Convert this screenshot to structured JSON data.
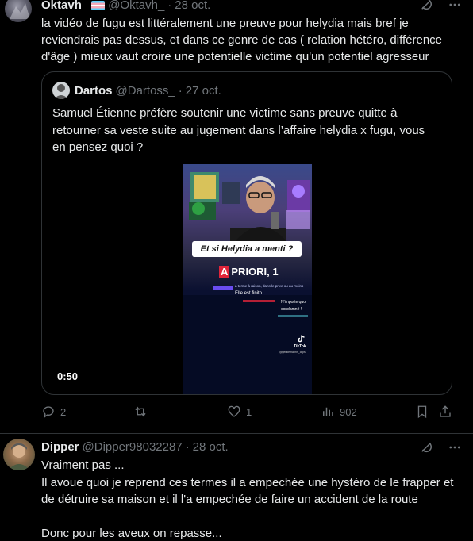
{
  "post1": {
    "name": "Oktavh_",
    "handle": "@Oktavh_",
    "separator": "·",
    "date": "28 oct.",
    "text": "la vidéo de fugu est littéralement une preuve pour helydia mais bref je reviendrais pas dessus, et dans ce genre de cas ( relation hétéro, différence d'âge ) mieux vaut croire une potentielle victime qu'un potentiel agresseur",
    "quote": {
      "name": "Dartos",
      "handle": "@Dartoss_",
      "separator": "·",
      "date": "27 oct.",
      "text": "Samuel Étienne préfère soutenir une victime sans preuve quitte à retourner sa veste suite au jugement dans l’affaire helydia x fugu, vous en pensez quoi ?",
      "video": {
        "duration": "0:50",
        "caption": "Et si Helydia a menti ?",
        "show_badge": "A",
        "show_title": "PRIORI, 1",
        "chat_line_1": "a terme à raison, dans le prive ou au moins",
        "chat_line_2": "Elle est finito",
        "chat_line_3": "N'importe quoi",
        "chat_line_4": "condamné !",
        "tiktok_label": "TikTok",
        "tiktok_user": "@gentlemanhn_clips"
      }
    },
    "actions": {
      "replies": "2",
      "reposts": "",
      "likes": "1",
      "views": "902"
    }
  },
  "post2": {
    "name": "Dipper",
    "handle": "@Dipper98032287",
    "separator": "·",
    "date": "28 oct.",
    "line1": "Vraiment pas ...",
    "line2": "Il avoue quoi je reprend ces termes il a empechée une hystéro de le frapper et de détruire sa maison et il l'a empechée de faire un accident de la route",
    "line3": "Donc pour les aveux on repasse..."
  },
  "icons": {
    "grok": "grok-icon",
    "more": "more-icon",
    "reply": "reply-icon",
    "repost": "repost-icon",
    "like": "like-icon",
    "views": "views-icon",
    "bookmark": "bookmark-icon",
    "share": "share-icon",
    "tiktok": "tiktok-icon"
  },
  "colors": {
    "background": "#000000",
    "text": "#e7e9ea",
    "muted": "#71767b",
    "border": "#2f3336"
  }
}
